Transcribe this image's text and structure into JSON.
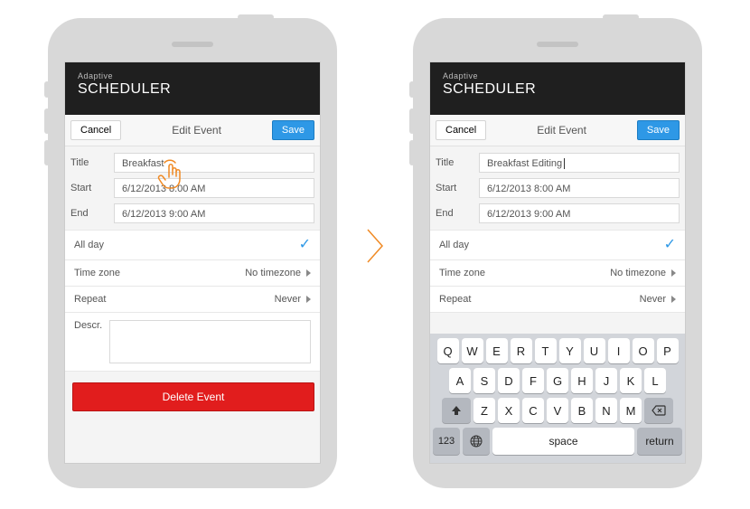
{
  "app": {
    "subtitle": "Adaptive",
    "title": "SCHEDULER"
  },
  "toolbar": {
    "cancel": "Cancel",
    "title": "Edit Event",
    "save": "Save"
  },
  "left": {
    "title_label": "Title",
    "title_value": "Breakfast",
    "start_label": "Start",
    "start_value": "6/12/2013 8:00 AM",
    "end_label": "End",
    "end_value": "6/12/2013 9:00 AM",
    "allday_label": "All day",
    "tz_label": "Time zone",
    "tz_value": "No timezone",
    "repeat_label": "Repeat",
    "repeat_value": "Never",
    "desc_label": "Descr.",
    "delete": "Delete Event"
  },
  "right": {
    "title_label": "Title",
    "title_value": "Breakfast Editing",
    "start_label": "Start",
    "start_value": "6/12/2013 8:00 AM",
    "end_label": "End",
    "end_value": "6/12/2013 9:00 AM",
    "allday_label": "All day",
    "tz_label": "Time zone",
    "tz_value": "No timezone",
    "repeat_label": "Repeat",
    "repeat_value": "Never"
  },
  "keyboard": {
    "row1": [
      "Q",
      "W",
      "E",
      "R",
      "T",
      "Y",
      "U",
      "I",
      "O",
      "P"
    ],
    "row2": [
      "A",
      "S",
      "D",
      "F",
      "G",
      "H",
      "J",
      "K",
      "L"
    ],
    "row3": [
      "Z",
      "X",
      "C",
      "V",
      "B",
      "N",
      "M"
    ],
    "num": "123",
    "space": "space",
    "return": "return"
  }
}
